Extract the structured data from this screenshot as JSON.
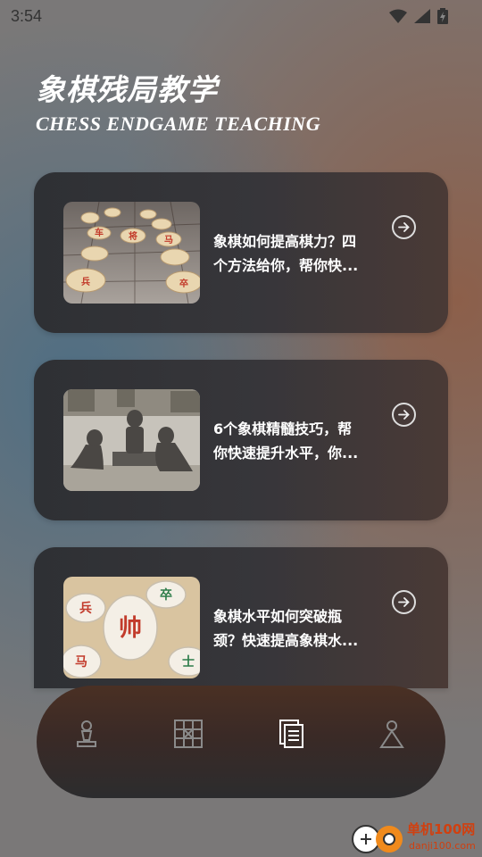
{
  "status": {
    "time": "3:54"
  },
  "header": {
    "title": "象棋残局教学",
    "subtitle": "CHESS ENDGAME TEACHING"
  },
  "articles": [
    {
      "title": "象棋如何提高棋力？四个方法给你，帮你快...",
      "line1": "象棋如何提高棋力？四",
      "line2": "个方法给你，帮你快..."
    },
    {
      "title": "6个象棋精髓技巧，帮你快速提升水平，你...",
      "line1": "6个象棋精髓技巧，帮",
      "line2": "你快速提升水平，你..."
    },
    {
      "title": "象棋水平如何突破瓶颈？快速提高象棋水...",
      "line1": "象棋水平如何突破瓶",
      "line2": "颈？快速提高象棋水..."
    }
  ],
  "nav": {
    "items": [
      "pawn-icon",
      "board-icon",
      "articles-icon",
      "profile-icon"
    ],
    "active": 2
  },
  "watermark": {
    "name": "单机100网",
    "url": "danji100.com"
  },
  "colors": {
    "accent": "#ffffff",
    "inactive": "#8a8a8a",
    "watermark": "#d04010"
  }
}
